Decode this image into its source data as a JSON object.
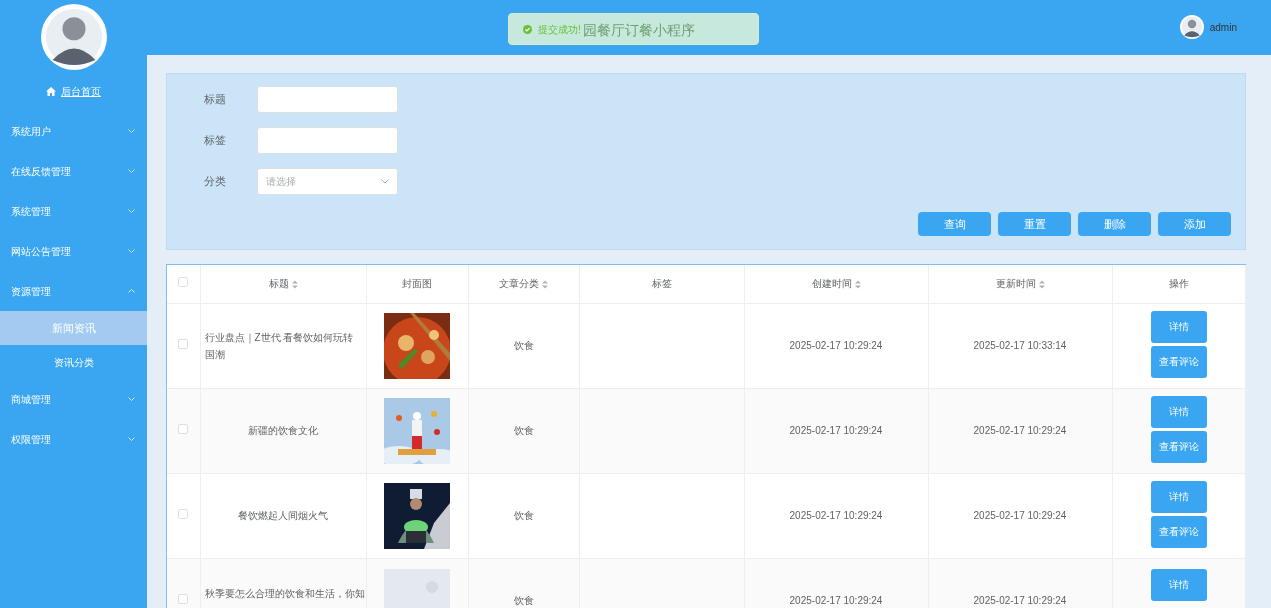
{
  "sidebar": {
    "home": "后台首页",
    "items": [
      {
        "label": "系统用户",
        "expanded": false
      },
      {
        "label": "在线反馈管理",
        "expanded": false
      },
      {
        "label": "系统管理",
        "expanded": false
      },
      {
        "label": "网站公告管理",
        "expanded": false
      },
      {
        "label": "资源管理",
        "expanded": true,
        "children": [
          {
            "label": "新闻资讯",
            "selected": true
          },
          {
            "label": "资讯分类",
            "selected": false
          }
        ]
      },
      {
        "label": "商城管理",
        "expanded": false
      },
      {
        "label": "权限管理",
        "expanded": false
      }
    ]
  },
  "header": {
    "title": "园餐厅订餐小程序",
    "user": "admin"
  },
  "toast": {
    "message": "提交成功!"
  },
  "filters": [
    {
      "kind": "input",
      "label": "标题"
    },
    {
      "kind": "input",
      "label": "标签"
    },
    {
      "kind": "select",
      "label": "分类",
      "placeholder": "请选择"
    }
  ],
  "actions": [
    "查询",
    "重置",
    "删除",
    "添加"
  ],
  "table": {
    "all_checked": false,
    "columns": [
      {
        "label": "标题",
        "sortable": true
      },
      {
        "label": "封面图",
        "sortable": false
      },
      {
        "label": "文章分类",
        "sortable": true
      },
      {
        "label": "标签",
        "sortable": false
      },
      {
        "label": "创建时间",
        "sortable": true
      },
      {
        "label": "更新时间",
        "sortable": true
      },
      {
        "label": "操作",
        "sortable": false
      }
    ],
    "rows": [
      {
        "checked": false,
        "title": "行业盘点｜Z世代 看餐饮如何玩转国潮",
        "category": "饮食",
        "created": "2025-02-17 10:29:24",
        "updated": "2025-02-17 10:33:14",
        "buttons": [
          "详情",
          "查看评论"
        ]
      },
      {
        "checked": false,
        "title": "新疆的饮食文化",
        "category": "饮食",
        "created": "2025-02-17 10:29:24",
        "updated": "2025-02-17 10:29:24",
        "buttons": [
          "详情",
          "查看评论"
        ]
      },
      {
        "checked": false,
        "title": "餐饮燃起人间烟火气",
        "category": "饮食",
        "created": "2025-02-17 10:29:24",
        "updated": "2025-02-17 10:29:24",
        "buttons": [
          "详情",
          "查看评论"
        ]
      },
      {
        "checked": false,
        "title": "秋季要怎么合理的饮食和生活，你知",
        "category": "饮食",
        "created": "2025-02-17 10:29:24",
        "updated": "2025-02-17 10:29:24",
        "buttons": [
          "详情"
        ]
      }
    ]
  }
}
